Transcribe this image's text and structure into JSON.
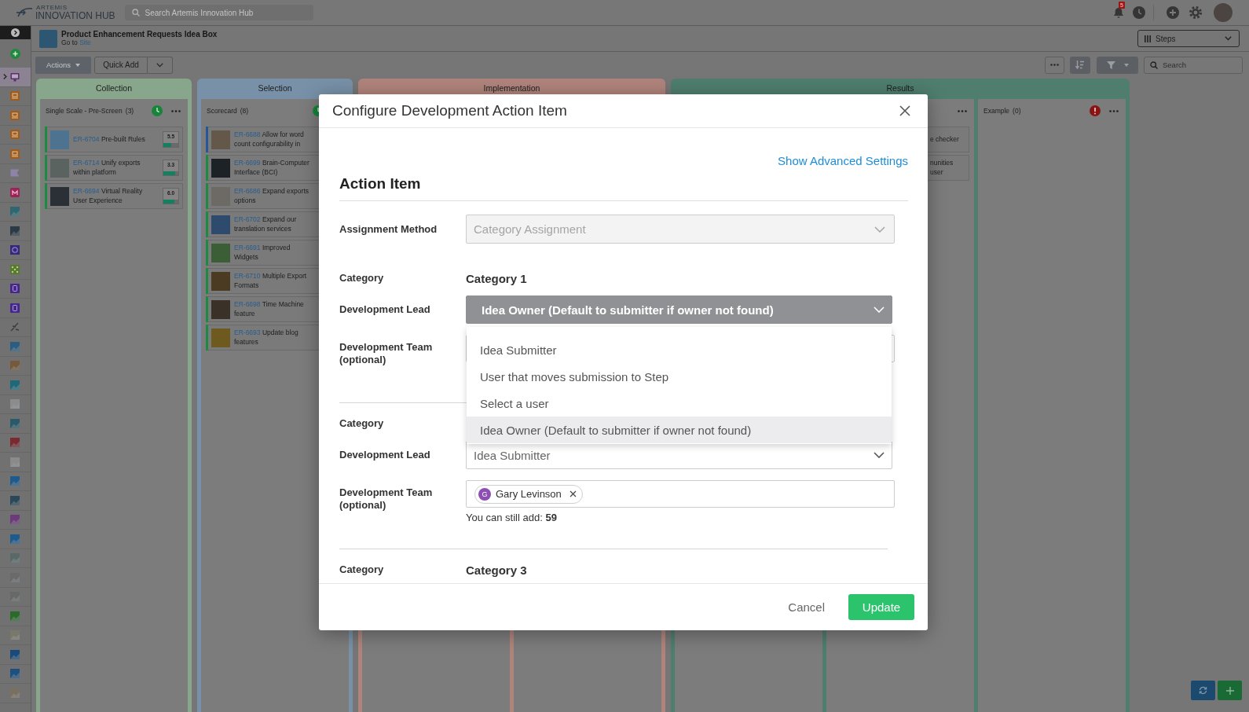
{
  "top_bar": {
    "logo": {
      "line_1": "ARTEMIS",
      "line_2": "INNOVATION HUB"
    },
    "search": {
      "placeholder": "Search Artemis Innovation Hub"
    },
    "notifications": "5"
  },
  "sidebar": {
    "collapsed": true,
    "items": [
      {
        "kind": "screen",
        "color": "#5c2e6b",
        "selected": true
      },
      {
        "kind": "laptop",
        "color": "#a05c1e",
        "selected": false
      },
      {
        "kind": "laptop",
        "color": "#a05c1e",
        "selected": false
      },
      {
        "kind": "laptop",
        "color": "#a05c1e",
        "selected": false
      },
      {
        "kind": "laptop",
        "color": "#a05c1e",
        "selected": false
      },
      {
        "kind": "flag",
        "color": "#8d84a6",
        "selected": false
      },
      {
        "kind": "badge",
        "color": "#9c2257",
        "selected": false
      },
      {
        "kind": "photo",
        "color": "#2f6670",
        "selected": false
      },
      {
        "kind": "photo",
        "color": "#2b3a44",
        "selected": false
      },
      {
        "kind": "target",
        "color": "#36287a",
        "selected": false
      },
      {
        "kind": "pattern",
        "color": "#587a2c",
        "selected": false
      },
      {
        "kind": "doc",
        "color": "#46278a",
        "selected": false
      },
      {
        "kind": "doc",
        "color": "#46278a",
        "selected": false
      },
      {
        "kind": "sketch",
        "color": "#3a3a3a",
        "selected": false
      },
      {
        "kind": "photo",
        "color": "#2a5d80",
        "selected": false
      },
      {
        "kind": "photo",
        "color": "#76583a",
        "selected": false
      },
      {
        "kind": "photo",
        "color": "#1f6878",
        "selected": false
      },
      {
        "kind": "photo",
        "color": "#8c8c8c",
        "selected": false
      },
      {
        "kind": "photo",
        "color": "#2a5a6a",
        "selected": false
      },
      {
        "kind": "photo",
        "color": "#7a2a2e",
        "selected": false
      },
      {
        "kind": "photo",
        "color": "#8a8a88",
        "selected": false
      },
      {
        "kind": "photo",
        "color": "#1f5a8c",
        "selected": false
      },
      {
        "kind": "photo",
        "color": "#2a4858",
        "selected": false
      },
      {
        "kind": "photo",
        "color": "#6c3a7a",
        "selected": false
      },
      {
        "kind": "photo",
        "color": "#1f5a8d",
        "selected": false
      },
      {
        "kind": "photo",
        "color": "#5a6868",
        "selected": false
      },
      {
        "kind": "photo",
        "color": "#6a6a6a",
        "selected": false
      },
      {
        "kind": "photo",
        "color": "#686868",
        "selected": false
      },
      {
        "kind": "photo",
        "color": "#2c6a2a",
        "selected": false
      },
      {
        "kind": "photo",
        "color": "#7a786a",
        "selected": false
      },
      {
        "kind": "photo",
        "color": "#1a4a7a",
        "selected": false
      },
      {
        "kind": "photo",
        "color": "#1d4f80",
        "selected": false
      },
      {
        "kind": "photo",
        "color": "#7a7060",
        "selected": false
      }
    ]
  },
  "project": {
    "title": "Product Enhancement Requests Idea Box",
    "go_to": "Go to",
    "link": "Site",
    "view": "Steps"
  },
  "toolbar": {
    "actions": "Actions",
    "quick_add": "Quick Add",
    "search": {
      "placeholder": "Search"
    }
  },
  "board": {
    "stages": [
      {
        "name": "Collection",
        "color": "#87a68b",
        "lists": [
          {
            "kind": "clock",
            "title": "Single Scale - Pre-Screen",
            "count": "(3)",
            "cards": [
              {
                "id": "ER-6704",
                "title": "Pre-built Rules",
                "color": "#1b8a43",
                "score": "5.5",
                "level": 0.53
              },
              {
                "id": "ER-6714",
                "title": "Unify exports within platform",
                "color": "#1b8a43",
                "score": "3.3",
                "level": 0.77
              },
              {
                "id": "ER-6694",
                "title": "Virtual Reality User Experience",
                "color": "#1b8a43",
                "score": "6.0",
                "level": 0.73
              }
            ]
          }
        ]
      },
      {
        "name": "Selection",
        "color": "#7891a8",
        "lists": [
          {
            "kind": "clock",
            "title": "Scorecard",
            "count": "(8)",
            "cards": [
              {
                "id": "ER-6688",
                "title": "Allow for word count configurability in",
                "color": "#24579a"
              },
              {
                "id": "ER-6699",
                "title": "Brain-Computer Interface (BCI)",
                "color": "#1b8a43"
              },
              {
                "id": "ER-6686",
                "title": "Expand exports options",
                "color": "#1b8a43"
              },
              {
                "id": "ER-6702",
                "title": "Expand our translation services",
                "color": "#1b8a43"
              },
              {
                "id": "ER-6691",
                "title": "Improved Widgets",
                "color": "#1b8a43"
              },
              {
                "id": "ER-6710",
                "title": "Multiple Export Formats",
                "color": "#1b8a43"
              },
              {
                "id": "ER-6698",
                "title": "Time Machine feature",
                "color": "#1b8a43"
              },
              {
                "id": "ER-6693",
                "title": "Update blog features",
                "color": "#1b8a43"
              }
            ]
          }
        ]
      },
      {
        "name": "Implementation",
        "color": "#b0847c"
      },
      {
        "name": "Results",
        "color": "#4f7e6e",
        "lists": [
          {
            "kind": "plain",
            "cards": [
              {
                "title": "e checker"
              },
              {
                "title": "nunities user"
              }
            ]
          },
          {
            "kind": "alert",
            "title": "Example",
            "count": "(0)"
          }
        ]
      }
    ]
  },
  "modal": {
    "title": "Configure Development Action Item",
    "advanced_settings": "Show Advanced Settings",
    "section": "Action Item",
    "assignment": {
      "label": "Assignment Method",
      "value": "Category Assignment",
      "disabled": true
    },
    "groups": [
      {
        "category_label": "Category",
        "category": "Category 1",
        "lead_label": "Development Lead",
        "lead": {
          "value": "Idea Owner (Default to submitter if owner not found)",
          "expanded": true,
          "options": [
            {
              "label": "Idea Submitter",
              "selected": false
            },
            {
              "label": "User that moves submission to Step",
              "selected": false
            },
            {
              "label": "Select a user",
              "selected": false
            },
            {
              "label": "Idea Owner (Default to submitter if owner not found)",
              "selected": true
            }
          ]
        },
        "team_label": "Development Team (optional)"
      },
      {
        "category_label": "Category",
        "lead_label": "Development Lead",
        "lead": {
          "value": "Idea Submitter",
          "expanded": false
        },
        "team_label": "Development Team (optional)",
        "team": [
          {
            "initial": "G",
            "name": "Gary Levinson"
          }
        ],
        "remaining": "You can still add: **59**"
      },
      {
        "category_label": "Category",
        "category": "Category 3"
      }
    ],
    "cancel": "Cancel",
    "update": "Update"
  }
}
